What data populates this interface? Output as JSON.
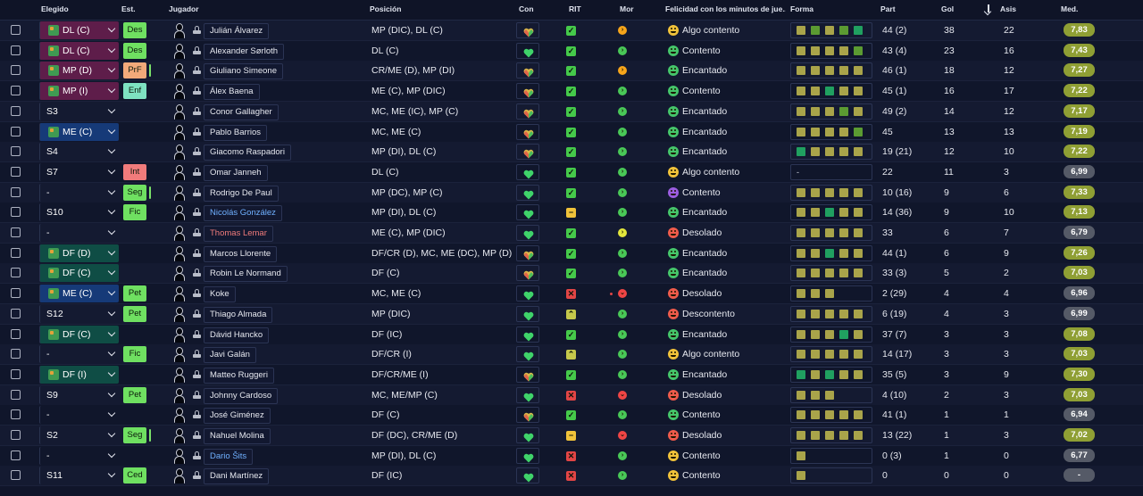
{
  "headers": {
    "elegido": "Elegido",
    "est": "Est.",
    "jugador": "Jugador",
    "posicion": "Posición",
    "con": "Con",
    "rit": "RIT",
    "mor": "Mor",
    "felicidad": "Felicidad con los minutos de jue…",
    "forma": "Forma",
    "part": "Part",
    "gol": "Gol",
    "asis": "Asis",
    "med": "Med."
  },
  "colors": {
    "sel": {
      "mag": "#5e1d4a",
      "grn": "#0f4d45",
      "blu": "#163a78"
    },
    "status": {
      "Des": "#6fe061",
      "PrF": "#f2a97a",
      "Enf": "#7ee2c1",
      "Int": "#f07b7b",
      "Seg": "#6fe061",
      "Fic": "#6fe061",
      "Pet": "#6fe061",
      "Ced": "#6fe061"
    },
    "rit": {
      "check": "#45c94a",
      "dash": "#f0c23a",
      "x": "#e24545",
      "up": "#c5c84b"
    },
    "mor": {
      "orange": "#f7a51a",
      "green": "#49c857",
      "yellow": "#e3e63c",
      "red": "#ef4545"
    },
    "face": {
      "green": "#45c56a",
      "yellow": "#f1c23a",
      "red": "#ee5b4b",
      "purple": "#9b5de0"
    },
    "form": {
      "olive": "#a9a44a",
      "green": "#5b9b32",
      "teal": "#20a060",
      "lime": "#83a53a"
    },
    "badge": {
      "olive": "#8f9f34",
      "lightgreen": "#6c9a2c",
      "grey": "#555a67"
    },
    "heart": {
      "green": "#3fd36a",
      "multi": "#d7b64a"
    }
  },
  "rows": [
    {
      "sel": "DL (C)",
      "selColor": "mag",
      "selIcon": true,
      "status": "Des",
      "name": "Julián Álvarez",
      "pos": "MP (DIC), DL (C)",
      "con": "multi",
      "rit": "check",
      "mor": "orange",
      "face": "yellow",
      "happy": "Algo contento",
      "form": [
        "olive",
        "green",
        "olive",
        "green",
        "teal"
      ],
      "part": "44 (2)",
      "gol": "38",
      "asis": "22",
      "med": "7,83",
      "medColor": "olive"
    },
    {
      "sel": "DL (C)",
      "selColor": "mag",
      "selIcon": true,
      "status": "Des",
      "name": "Alexander Sørloth",
      "pos": "DL (C)",
      "con": "green",
      "rit": "check",
      "mor": "green",
      "face": "green",
      "happy": "Contento",
      "form": [
        "olive",
        "olive",
        "olive",
        "olive",
        "green"
      ],
      "part": "43 (4)",
      "gol": "23",
      "asis": "16",
      "med": "7,43",
      "medColor": "olive"
    },
    {
      "sel": "MP (D)",
      "selColor": "mag",
      "selIcon": true,
      "status": "PrF",
      "statusTail": true,
      "name": "Giuliano Simeone",
      "pos": "CR/ME (D), MP (DI)",
      "con": "multi",
      "rit": "check",
      "mor": "orange",
      "face": "green",
      "happy": "Encantado",
      "form": [
        "olive",
        "olive",
        "olive",
        "olive",
        "olive"
      ],
      "part": "46 (1)",
      "gol": "18",
      "asis": "12",
      "med": "7,27",
      "medColor": "olive"
    },
    {
      "sel": "MP (I)",
      "selColor": "mag",
      "selIcon": true,
      "status": "Enf",
      "name": "Álex Baena",
      "pos": "ME (C), MP (DIC)",
      "con": "multi",
      "rit": "check",
      "mor": "green",
      "face": "green",
      "happy": "Contento",
      "form": [
        "olive",
        "olive",
        "teal",
        "olive",
        "olive"
      ],
      "part": "45 (1)",
      "gol": "16",
      "asis": "17",
      "med": "7,22",
      "medColor": "olive"
    },
    {
      "sel": "S3",
      "selColor": "plain",
      "selIcon": false,
      "status": "",
      "name": "Conor Gallagher",
      "pos": "MC, ME (IC), MP (C)",
      "con": "multi",
      "rit": "check",
      "mor": "green",
      "face": "green",
      "happy": "Encantado",
      "form": [
        "olive",
        "olive",
        "olive",
        "green",
        "olive"
      ],
      "part": "49 (2)",
      "gol": "14",
      "asis": "12",
      "med": "7,17",
      "medColor": "olive"
    },
    {
      "sel": "ME (C)",
      "selColor": "blu",
      "selIcon": true,
      "status": "",
      "name": "Pablo Barrios",
      "pos": "MC, ME (C)",
      "con": "multi",
      "rit": "check",
      "mor": "green",
      "face": "green",
      "happy": "Encantado",
      "form": [
        "olive",
        "olive",
        "olive",
        "olive",
        "green"
      ],
      "part": "45",
      "gol": "13",
      "asis": "13",
      "med": "7,19",
      "medColor": "olive"
    },
    {
      "sel": "S4",
      "selColor": "plain",
      "selIcon": false,
      "status": "",
      "name": "Giacomo Raspadori",
      "pos": "MP (DI), DL (C)",
      "con": "multi",
      "rit": "check",
      "mor": "green",
      "face": "green",
      "happy": "Encantado",
      "form": [
        "teal",
        "olive",
        "olive",
        "olive",
        "olive"
      ],
      "part": "19 (21)",
      "gol": "12",
      "asis": "10",
      "med": "7,22",
      "medColor": "olive"
    },
    {
      "sel": "S7",
      "selColor": "plain",
      "selIcon": false,
      "status": "Int",
      "name": "Omar Janneh",
      "pos": "DL (C)",
      "con": "green",
      "rit": "check",
      "mor": "green",
      "face": "yellow",
      "happy": "Algo contento",
      "formDash": "-",
      "form": [],
      "part": "22",
      "gol": "11",
      "asis": "3",
      "med": "6,99",
      "medColor": "grey"
    },
    {
      "sel": "-",
      "selColor": "plain",
      "selIcon": false,
      "status": "Seg",
      "statusTail": true,
      "name": "Rodrigo De Paul",
      "pos": "MP (DC), MP (C)",
      "con": "green",
      "rit": "check",
      "mor": "green",
      "face": "purple",
      "happy": "Contento",
      "form": [
        "olive",
        "olive",
        "olive",
        "olive",
        "olive"
      ],
      "part": "10 (16)",
      "gol": "9",
      "asis": "6",
      "med": "7,33",
      "medColor": "olive"
    },
    {
      "sel": "S10",
      "selColor": "plain",
      "selIcon": false,
      "status": "Fic",
      "name": "Nicolás González",
      "nameColor": "#6fb0ff",
      "pos": "MP (DI), DL (C)",
      "con": "green",
      "rit": "dash",
      "mor": "green",
      "face": "green",
      "happy": "Encantado",
      "form": [
        "olive",
        "olive",
        "teal",
        "olive",
        "olive"
      ],
      "part": "14 (36)",
      "gol": "9",
      "asis": "10",
      "med": "7,13",
      "medColor": "olive"
    },
    {
      "sel": "-",
      "selColor": "plain",
      "selIcon": false,
      "status": "",
      "name": "Thomas Lemar",
      "nameColor": "#f07b7b",
      "pos": "ME (C), MP (DIC)",
      "con": "green",
      "rit": "check",
      "mor": "yellow",
      "face": "red",
      "happy": "Desolado",
      "form": [
        "olive",
        "olive",
        "olive",
        "olive",
        "olive"
      ],
      "part": "33",
      "gol": "6",
      "asis": "7",
      "med": "6,79",
      "medColor": "grey"
    },
    {
      "sel": "DF (D)",
      "selColor": "grn",
      "selIcon": true,
      "status": "",
      "name": "Marcos Llorente",
      "pos": "DF/CR (D), MC, ME (DC), MP (D)",
      "con": "multi",
      "rit": "check",
      "mor": "green",
      "face": "green",
      "happy": "Encantado",
      "form": [
        "olive",
        "olive",
        "teal",
        "olive",
        "olive"
      ],
      "part": "44 (1)",
      "gol": "6",
      "asis": "9",
      "med": "7,26",
      "medColor": "olive"
    },
    {
      "sel": "DF (C)",
      "selColor": "grn",
      "selIcon": true,
      "status": "",
      "name": "Robin Le Normand",
      "pos": "DF (C)",
      "con": "multi",
      "rit": "check",
      "mor": "green",
      "face": "green",
      "happy": "Encantado",
      "form": [
        "olive",
        "olive",
        "olive",
        "olive",
        "olive"
      ],
      "part": "33 (3)",
      "gol": "5",
      "asis": "2",
      "med": "7,03",
      "medColor": "olive"
    },
    {
      "sel": "ME (C)",
      "selColor": "blu",
      "selIcon": true,
      "status": "Pet",
      "name": "Koke",
      "pos": "MC, ME (C)",
      "con": "green",
      "rit": "x",
      "mor": "red",
      "morDot": true,
      "face": "red",
      "happy": "Desolado",
      "form": [
        "olive",
        "olive",
        "olive"
      ],
      "part": "2 (29)",
      "gol": "4",
      "asis": "4",
      "med": "6,96",
      "medColor": "grey"
    },
    {
      "sel": "S12",
      "selColor": "plain",
      "selIcon": false,
      "status": "Pet",
      "name": "Thiago Almada",
      "pos": "MP (DIC)",
      "con": "green",
      "rit": "up",
      "mor": "green",
      "face": "red",
      "happy": "Descontento",
      "form": [
        "olive",
        "olive",
        "olive",
        "olive",
        "olive"
      ],
      "part": "6 (19)",
      "gol": "4",
      "asis": "3",
      "med": "6,99",
      "medColor": "grey"
    },
    {
      "sel": "DF (C)",
      "selColor": "grn",
      "selIcon": true,
      "status": "",
      "name": "Dávid Hancko",
      "pos": "DF (IC)",
      "con": "green",
      "rit": "check",
      "mor": "green",
      "face": "green",
      "happy": "Encantado",
      "form": [
        "olive",
        "olive",
        "olive",
        "teal",
        "olive"
      ],
      "part": "37 (7)",
      "gol": "3",
      "asis": "3",
      "med": "7,08",
      "medColor": "olive"
    },
    {
      "sel": "-",
      "selColor": "plain",
      "selIcon": false,
      "status": "Fic",
      "name": "Javi Galán",
      "pos": "DF/CR (I)",
      "con": "green",
      "rit": "up",
      "mor": "green",
      "face": "yellow",
      "happy": "Algo contento",
      "form": [
        "olive",
        "olive",
        "olive",
        "olive",
        "olive"
      ],
      "part": "14 (17)",
      "gol": "3",
      "asis": "3",
      "med": "7,03",
      "medColor": "olive"
    },
    {
      "sel": "DF (I)",
      "selColor": "grn",
      "selIcon": true,
      "status": "",
      "name": "Matteo Ruggeri",
      "pos": "DF/CR/ME (I)",
      "con": "multi",
      "rit": "check",
      "mor": "green",
      "face": "green",
      "happy": "Encantado",
      "form": [
        "teal",
        "olive",
        "teal",
        "olive",
        "olive"
      ],
      "part": "35 (5)",
      "gol": "3",
      "asis": "9",
      "med": "7,30",
      "medColor": "olive"
    },
    {
      "sel": "S9",
      "selColor": "plain",
      "selIcon": false,
      "status": "Pet",
      "name": "Johnny Cardoso",
      "pos": "MC, ME/MP (C)",
      "con": "green",
      "rit": "x",
      "mor": "red",
      "face": "red",
      "happy": "Desolado",
      "form": [
        "olive",
        "olive",
        "olive"
      ],
      "part": "4 (10)",
      "gol": "2",
      "asis": "3",
      "med": "7,03",
      "medColor": "olive"
    },
    {
      "sel": "-",
      "selColor": "plain",
      "selIcon": false,
      "status": "",
      "name": "José Giménez",
      "pos": "DF (C)",
      "con": "multi",
      "rit": "check",
      "mor": "green",
      "face": "green",
      "happy": "Contento",
      "form": [
        "olive",
        "olive",
        "olive",
        "olive",
        "olive"
      ],
      "part": "41 (1)",
      "gol": "1",
      "asis": "1",
      "med": "6,94",
      "medColor": "grey"
    },
    {
      "sel": "S2",
      "selColor": "plain",
      "selIcon": false,
      "status": "Seg",
      "statusTail": true,
      "name": "Nahuel Molina",
      "pos": "DF (DC), CR/ME (D)",
      "con": "green",
      "rit": "dash",
      "mor": "red",
      "face": "red",
      "happy": "Desolado",
      "form": [
        "olive",
        "olive",
        "olive",
        "olive",
        "olive"
      ],
      "part": "13 (22)",
      "gol": "1",
      "asis": "3",
      "med": "7,02",
      "medColor": "olive"
    },
    {
      "sel": "-",
      "selColor": "plain",
      "selIcon": false,
      "status": "",
      "name": "Dario Šits",
      "nameColor": "#6fb0ff",
      "pos": "MP (DI), DL (C)",
      "con": "green",
      "rit": "x",
      "mor": "green",
      "face": "yellow",
      "happy": "Contento",
      "form": [
        "olive"
      ],
      "part": "0 (3)",
      "gol": "1",
      "asis": "0",
      "med": "6,77",
      "medColor": "grey"
    },
    {
      "sel": "S11",
      "selColor": "plain",
      "selIcon": false,
      "status": "Ced",
      "name": "Dani Martínez",
      "pos": "DF (IC)",
      "con": "green",
      "rit": "x",
      "mor": "green",
      "face": "yellow",
      "happy": "Contento",
      "form": [
        "olive"
      ],
      "part": "0",
      "gol": "0",
      "asis": "0",
      "med": "-",
      "medColor": "grey"
    }
  ]
}
